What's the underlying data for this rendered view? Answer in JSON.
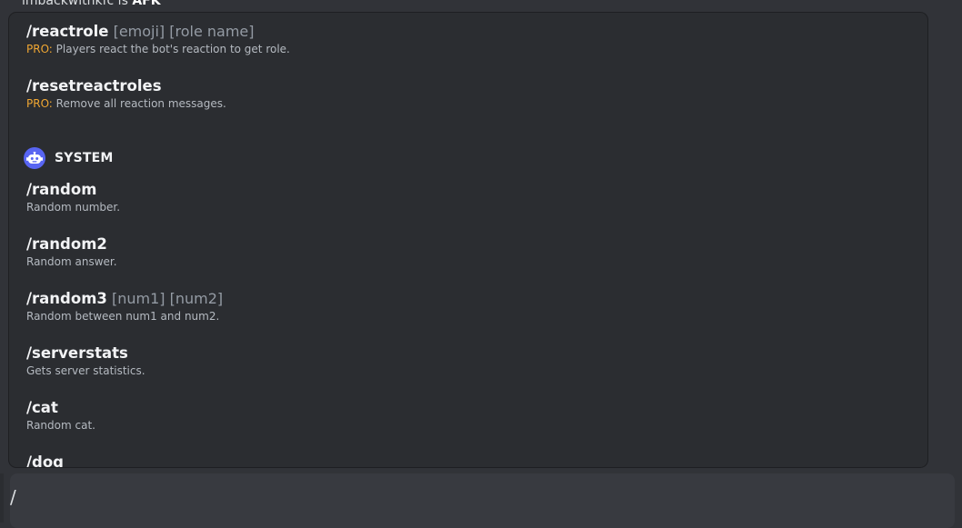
{
  "status": {
    "user": "imbackwithkfc",
    "verb": " is ",
    "state": "AFK"
  },
  "commands_top": [
    {
      "name": "/reactrole",
      "args": " [emoji] [role name]",
      "pro": "PRO:",
      "desc": " Players react the bot's reaction to get role."
    },
    {
      "name": "/resetreactroles",
      "args": "",
      "pro": "PRO:",
      "desc": " Remove all reaction messages."
    }
  ],
  "section": {
    "title": "SYSTEM",
    "icon": "discord-bot-icon"
  },
  "commands_system": [
    {
      "name": "/random",
      "args": "",
      "desc": "Random number."
    },
    {
      "name": "/random2",
      "args": "",
      "desc": "Random answer."
    },
    {
      "name": "/random3",
      "args": " [num1] [num2]",
      "desc": "Random between num1 and num2."
    },
    {
      "name": "/serverstats",
      "args": "",
      "desc": "Gets server statistics."
    },
    {
      "name": "/cat",
      "args": "",
      "desc": "Random cat."
    },
    {
      "name": "/dog",
      "args": "",
      "desc": ""
    }
  ],
  "composer": {
    "value": "/"
  },
  "colors": {
    "background": "#313338",
    "popup": "#2b2d31",
    "pro": "#f0a732",
    "accent": "#5865f2"
  }
}
